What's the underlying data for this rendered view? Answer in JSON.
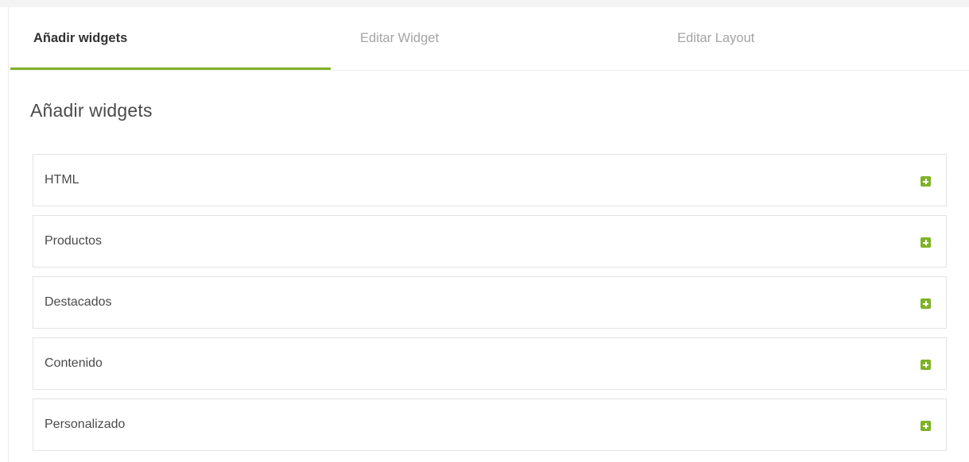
{
  "tabs": [
    {
      "label": "Añadir widgets",
      "active": true
    },
    {
      "label": "Editar Widget",
      "active": false
    },
    {
      "label": "Editar Layout",
      "active": false
    }
  ],
  "section": {
    "title": "Añadir widgets"
  },
  "widgets": [
    {
      "label": "HTML",
      "icon": "plus-icon"
    },
    {
      "label": "Productos",
      "icon": "plus-icon"
    },
    {
      "label": "Destacados",
      "icon": "plus-icon"
    },
    {
      "label": "Contenido",
      "icon": "plus-icon"
    },
    {
      "label": "Personalizado",
      "icon": "plus-icon"
    }
  ],
  "colors": {
    "accent": "#7fb227",
    "text": "#4a4a4a",
    "muted_tab": "#a4a4a4"
  }
}
